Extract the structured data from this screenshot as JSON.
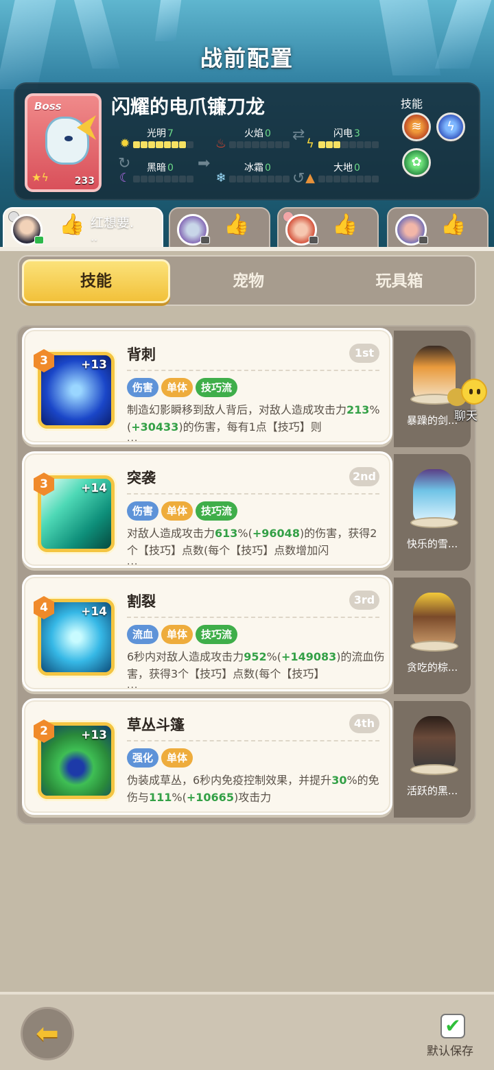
{
  "header": {
    "title": "战前配置"
  },
  "boss": {
    "tag": "Boss",
    "name": "闪耀的电爪镰刀龙",
    "level": "233",
    "attributes": [
      {
        "name": "光明",
        "value": "7",
        "level": 7
      },
      {
        "name": "火焰",
        "value": "0",
        "level": 0
      },
      {
        "name": "闪电",
        "value": "3",
        "level": 3
      },
      {
        "name": "黑暗",
        "value": "0",
        "level": 0
      },
      {
        "name": "冰霜",
        "value": "0",
        "level": 0
      },
      {
        "name": "大地",
        "value": "0",
        "level": 0
      }
    ],
    "skills_label": "技能",
    "skill_icons": [
      "claw-fire-icon",
      "lightning-icon",
      "nature-icon"
    ]
  },
  "characters": [
    {
      "name": "红想要.",
      "name_line2": "..",
      "active": true
    },
    {
      "name": "",
      "active": false
    },
    {
      "name": "",
      "active": false
    },
    {
      "name": "",
      "active": false
    }
  ],
  "tabs": {
    "skills": "技能",
    "pets": "宠物",
    "toybox": "玩具箱"
  },
  "skills": [
    {
      "level": "3",
      "plus": "+13",
      "name": "背刺",
      "rank": "1st",
      "tags": [
        "伤害",
        "单体",
        "技巧流"
      ],
      "desc_a": "制造幻影瞬移到敌人背后，对敌人造成攻击力",
      "hl1": "213",
      "mid1": "%(",
      "hl2": "+30433",
      "desc_b": ")的伤害，每有1点【技巧】则",
      "more": "...",
      "pet": "暴躁的剑..."
    },
    {
      "level": "3",
      "plus": "+14",
      "name": "突袭",
      "rank": "2nd",
      "tags": [
        "伤害",
        "单体",
        "技巧流"
      ],
      "desc_a": "对敌人造成攻击力",
      "hl1": "613",
      "mid1": "%(",
      "hl2": "+96048",
      "desc_b": ")的伤害，获得2个【技巧】点数(每个【技巧】点数增加闪",
      "more": "...",
      "pet": "快乐的雪..."
    },
    {
      "level": "4",
      "plus": "+14",
      "name": "割裂",
      "rank": "3rd",
      "tags": [
        "流血",
        "单体",
        "技巧流"
      ],
      "desc_a": "6秒内对敌人造成攻击力",
      "hl1": "952",
      "mid1": "%(",
      "hl2": "+149083",
      "desc_b": ")的流血伤害，获得3个【技巧】点数(每个【技巧】",
      "more": "...",
      "pet": "贪吃的棕..."
    },
    {
      "level": "2",
      "plus": "+13",
      "name": "草丛斗篷",
      "rank": "4th",
      "tags": [
        "强化",
        "单体"
      ],
      "desc_a": "伪装成草丛，6秒内免疫控制效果，并提升",
      "hl0": "30",
      "desc_a2": "%的免伤与",
      "hl1": "111",
      "mid1": "%(",
      "hl2": "+10665",
      "desc_b": ")攻击力",
      "more": "",
      "pet": "活跃的黑..."
    }
  ],
  "chat": {
    "label": "聊天"
  },
  "footer": {
    "save_label": "默认保存"
  }
}
